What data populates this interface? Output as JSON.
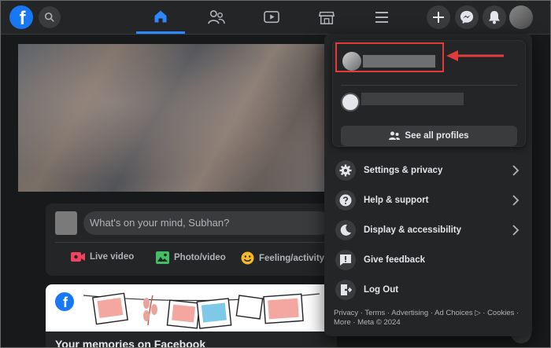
{
  "nav": {
    "tabs": [
      "home",
      "friends",
      "watch",
      "marketplace",
      "menu"
    ]
  },
  "composer": {
    "placeholder": "What's on your mind, Subhan?",
    "actions": [
      {
        "label": "Live video",
        "color": "#f3425f"
      },
      {
        "label": "Photo/video",
        "color": "#45bd62"
      },
      {
        "label": "Feeling/activity",
        "color": "#f7b928"
      }
    ]
  },
  "memories": {
    "title": "Your memories on Facebook"
  },
  "menu": {
    "see_all_profiles": "See all profiles",
    "items": [
      {
        "label": "Settings & privacy",
        "icon": "gear-icon",
        "chevron": true
      },
      {
        "label": "Help & support",
        "icon": "question-icon",
        "chevron": true
      },
      {
        "label": "Display & accessibility",
        "icon": "moon-icon",
        "chevron": true
      },
      {
        "label": "Give feedback",
        "icon": "feedback-icon",
        "chevron": false
      },
      {
        "label": "Log Out",
        "icon": "logout-icon",
        "chevron": false
      }
    ],
    "footer": "Privacy · Terms · Advertising · Ad Choices ▷ · Cookies · More · Meta © 2024"
  },
  "colors": {
    "accent": "#2d88ff",
    "brand": "#1877f2",
    "annotation": "#e23b3b"
  }
}
